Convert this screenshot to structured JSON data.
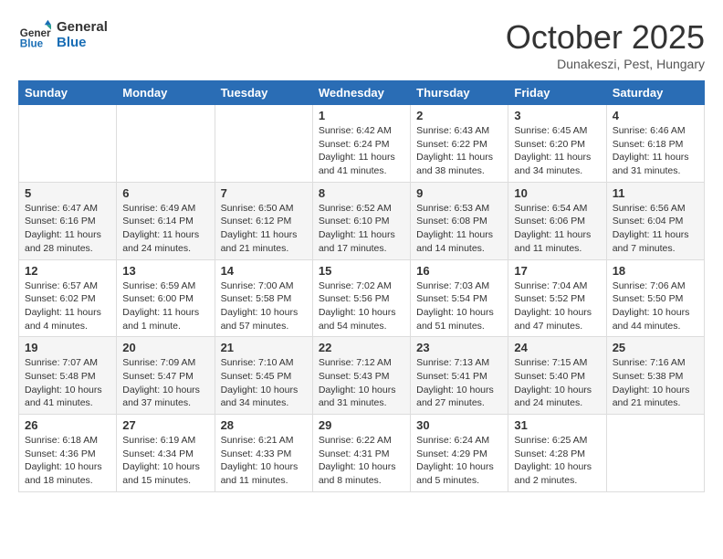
{
  "logo": {
    "line1": "General",
    "line2": "Blue"
  },
  "title": "October 2025",
  "location": "Dunakeszi, Pest, Hungary",
  "weekdays": [
    "Sunday",
    "Monday",
    "Tuesday",
    "Wednesday",
    "Thursday",
    "Friday",
    "Saturday"
  ],
  "weeks": [
    [
      {
        "day": "",
        "info": ""
      },
      {
        "day": "",
        "info": ""
      },
      {
        "day": "",
        "info": ""
      },
      {
        "day": "1",
        "info": "Sunrise: 6:42 AM\nSunset: 6:24 PM\nDaylight: 11 hours and 41 minutes."
      },
      {
        "day": "2",
        "info": "Sunrise: 6:43 AM\nSunset: 6:22 PM\nDaylight: 11 hours and 38 minutes."
      },
      {
        "day": "3",
        "info": "Sunrise: 6:45 AM\nSunset: 6:20 PM\nDaylight: 11 hours and 34 minutes."
      },
      {
        "day": "4",
        "info": "Sunrise: 6:46 AM\nSunset: 6:18 PM\nDaylight: 11 hours and 31 minutes."
      }
    ],
    [
      {
        "day": "5",
        "info": "Sunrise: 6:47 AM\nSunset: 6:16 PM\nDaylight: 11 hours and 28 minutes."
      },
      {
        "day": "6",
        "info": "Sunrise: 6:49 AM\nSunset: 6:14 PM\nDaylight: 11 hours and 24 minutes."
      },
      {
        "day": "7",
        "info": "Sunrise: 6:50 AM\nSunset: 6:12 PM\nDaylight: 11 hours and 21 minutes."
      },
      {
        "day": "8",
        "info": "Sunrise: 6:52 AM\nSunset: 6:10 PM\nDaylight: 11 hours and 17 minutes."
      },
      {
        "day": "9",
        "info": "Sunrise: 6:53 AM\nSunset: 6:08 PM\nDaylight: 11 hours and 14 minutes."
      },
      {
        "day": "10",
        "info": "Sunrise: 6:54 AM\nSunset: 6:06 PM\nDaylight: 11 hours and 11 minutes."
      },
      {
        "day": "11",
        "info": "Sunrise: 6:56 AM\nSunset: 6:04 PM\nDaylight: 11 hours and 7 minutes."
      }
    ],
    [
      {
        "day": "12",
        "info": "Sunrise: 6:57 AM\nSunset: 6:02 PM\nDaylight: 11 hours and 4 minutes."
      },
      {
        "day": "13",
        "info": "Sunrise: 6:59 AM\nSunset: 6:00 PM\nDaylight: 11 hours and 1 minute."
      },
      {
        "day": "14",
        "info": "Sunrise: 7:00 AM\nSunset: 5:58 PM\nDaylight: 10 hours and 57 minutes."
      },
      {
        "day": "15",
        "info": "Sunrise: 7:02 AM\nSunset: 5:56 PM\nDaylight: 10 hours and 54 minutes."
      },
      {
        "day": "16",
        "info": "Sunrise: 7:03 AM\nSunset: 5:54 PM\nDaylight: 10 hours and 51 minutes."
      },
      {
        "day": "17",
        "info": "Sunrise: 7:04 AM\nSunset: 5:52 PM\nDaylight: 10 hours and 47 minutes."
      },
      {
        "day": "18",
        "info": "Sunrise: 7:06 AM\nSunset: 5:50 PM\nDaylight: 10 hours and 44 minutes."
      }
    ],
    [
      {
        "day": "19",
        "info": "Sunrise: 7:07 AM\nSunset: 5:48 PM\nDaylight: 10 hours and 41 minutes."
      },
      {
        "day": "20",
        "info": "Sunrise: 7:09 AM\nSunset: 5:47 PM\nDaylight: 10 hours and 37 minutes."
      },
      {
        "day": "21",
        "info": "Sunrise: 7:10 AM\nSunset: 5:45 PM\nDaylight: 10 hours and 34 minutes."
      },
      {
        "day": "22",
        "info": "Sunrise: 7:12 AM\nSunset: 5:43 PM\nDaylight: 10 hours and 31 minutes."
      },
      {
        "day": "23",
        "info": "Sunrise: 7:13 AM\nSunset: 5:41 PM\nDaylight: 10 hours and 27 minutes."
      },
      {
        "day": "24",
        "info": "Sunrise: 7:15 AM\nSunset: 5:40 PM\nDaylight: 10 hours and 24 minutes."
      },
      {
        "day": "25",
        "info": "Sunrise: 7:16 AM\nSunset: 5:38 PM\nDaylight: 10 hours and 21 minutes."
      }
    ],
    [
      {
        "day": "26",
        "info": "Sunrise: 6:18 AM\nSunset: 4:36 PM\nDaylight: 10 hours and 18 minutes."
      },
      {
        "day": "27",
        "info": "Sunrise: 6:19 AM\nSunset: 4:34 PM\nDaylight: 10 hours and 15 minutes."
      },
      {
        "day": "28",
        "info": "Sunrise: 6:21 AM\nSunset: 4:33 PM\nDaylight: 10 hours and 11 minutes."
      },
      {
        "day": "29",
        "info": "Sunrise: 6:22 AM\nSunset: 4:31 PM\nDaylight: 10 hours and 8 minutes."
      },
      {
        "day": "30",
        "info": "Sunrise: 6:24 AM\nSunset: 4:29 PM\nDaylight: 10 hours and 5 minutes."
      },
      {
        "day": "31",
        "info": "Sunrise: 6:25 AM\nSunset: 4:28 PM\nDaylight: 10 hours and 2 minutes."
      },
      {
        "day": "",
        "info": ""
      }
    ]
  ]
}
